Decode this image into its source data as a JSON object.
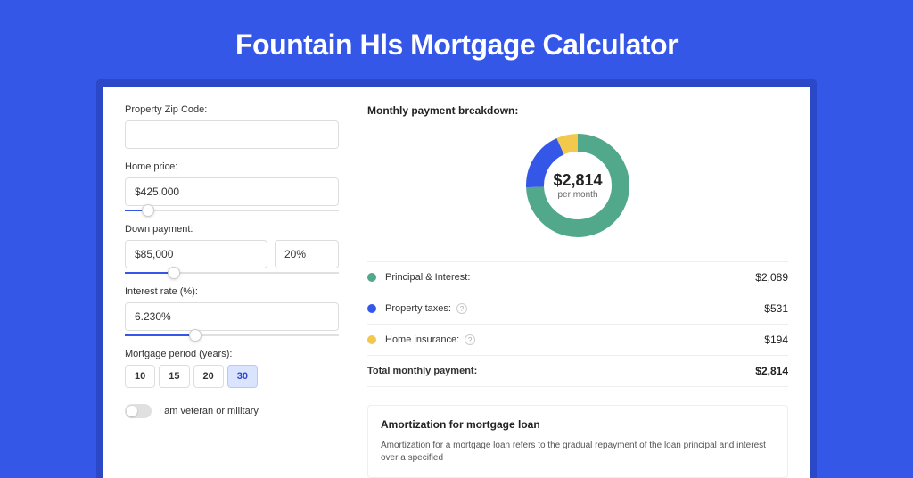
{
  "hero": {
    "title": "Fountain Hls Mortgage Calculator"
  },
  "form": {
    "zip": {
      "label": "Property Zip Code:",
      "value": ""
    },
    "price": {
      "label": "Home price:",
      "value": "$425,000",
      "slider_pct": 8
    },
    "down": {
      "label": "Down payment:",
      "value": "$85,000",
      "pct": "20%",
      "slider_pct": 20
    },
    "rate": {
      "label": "Interest rate (%):",
      "value": "6.230%",
      "slider_pct": 30
    },
    "period": {
      "label": "Mortgage period (years):",
      "options": [
        "10",
        "15",
        "20",
        "30"
      ],
      "active": "30"
    },
    "veteran": {
      "label": "I am veteran or military",
      "on": false
    }
  },
  "breakdown": {
    "title": "Monthly payment breakdown:",
    "center_amount": "$2,814",
    "center_sub": "per month",
    "items": [
      {
        "label": "Principal & Interest:",
        "value": "$2,089",
        "color": "#52a88a",
        "help": false
      },
      {
        "label": "Property taxes:",
        "value": "$531",
        "color": "#3557e8",
        "help": true
      },
      {
        "label": "Home insurance:",
        "value": "$194",
        "color": "#f2c94c",
        "help": true
      }
    ],
    "total": {
      "label": "Total monthly payment:",
      "value": "$2,814"
    }
  },
  "amort": {
    "title": "Amortization for mortgage loan",
    "text": "Amortization for a mortgage loan refers to the gradual repayment of the loan principal and interest over a specified"
  },
  "chart_data": {
    "type": "pie",
    "title": "Monthly payment breakdown",
    "categories": [
      "Principal & Interest",
      "Property taxes",
      "Home insurance"
    ],
    "values": [
      2089,
      531,
      194
    ],
    "colors": [
      "#52a88a",
      "#3557e8",
      "#f2c94c"
    ],
    "total": 2814
  }
}
